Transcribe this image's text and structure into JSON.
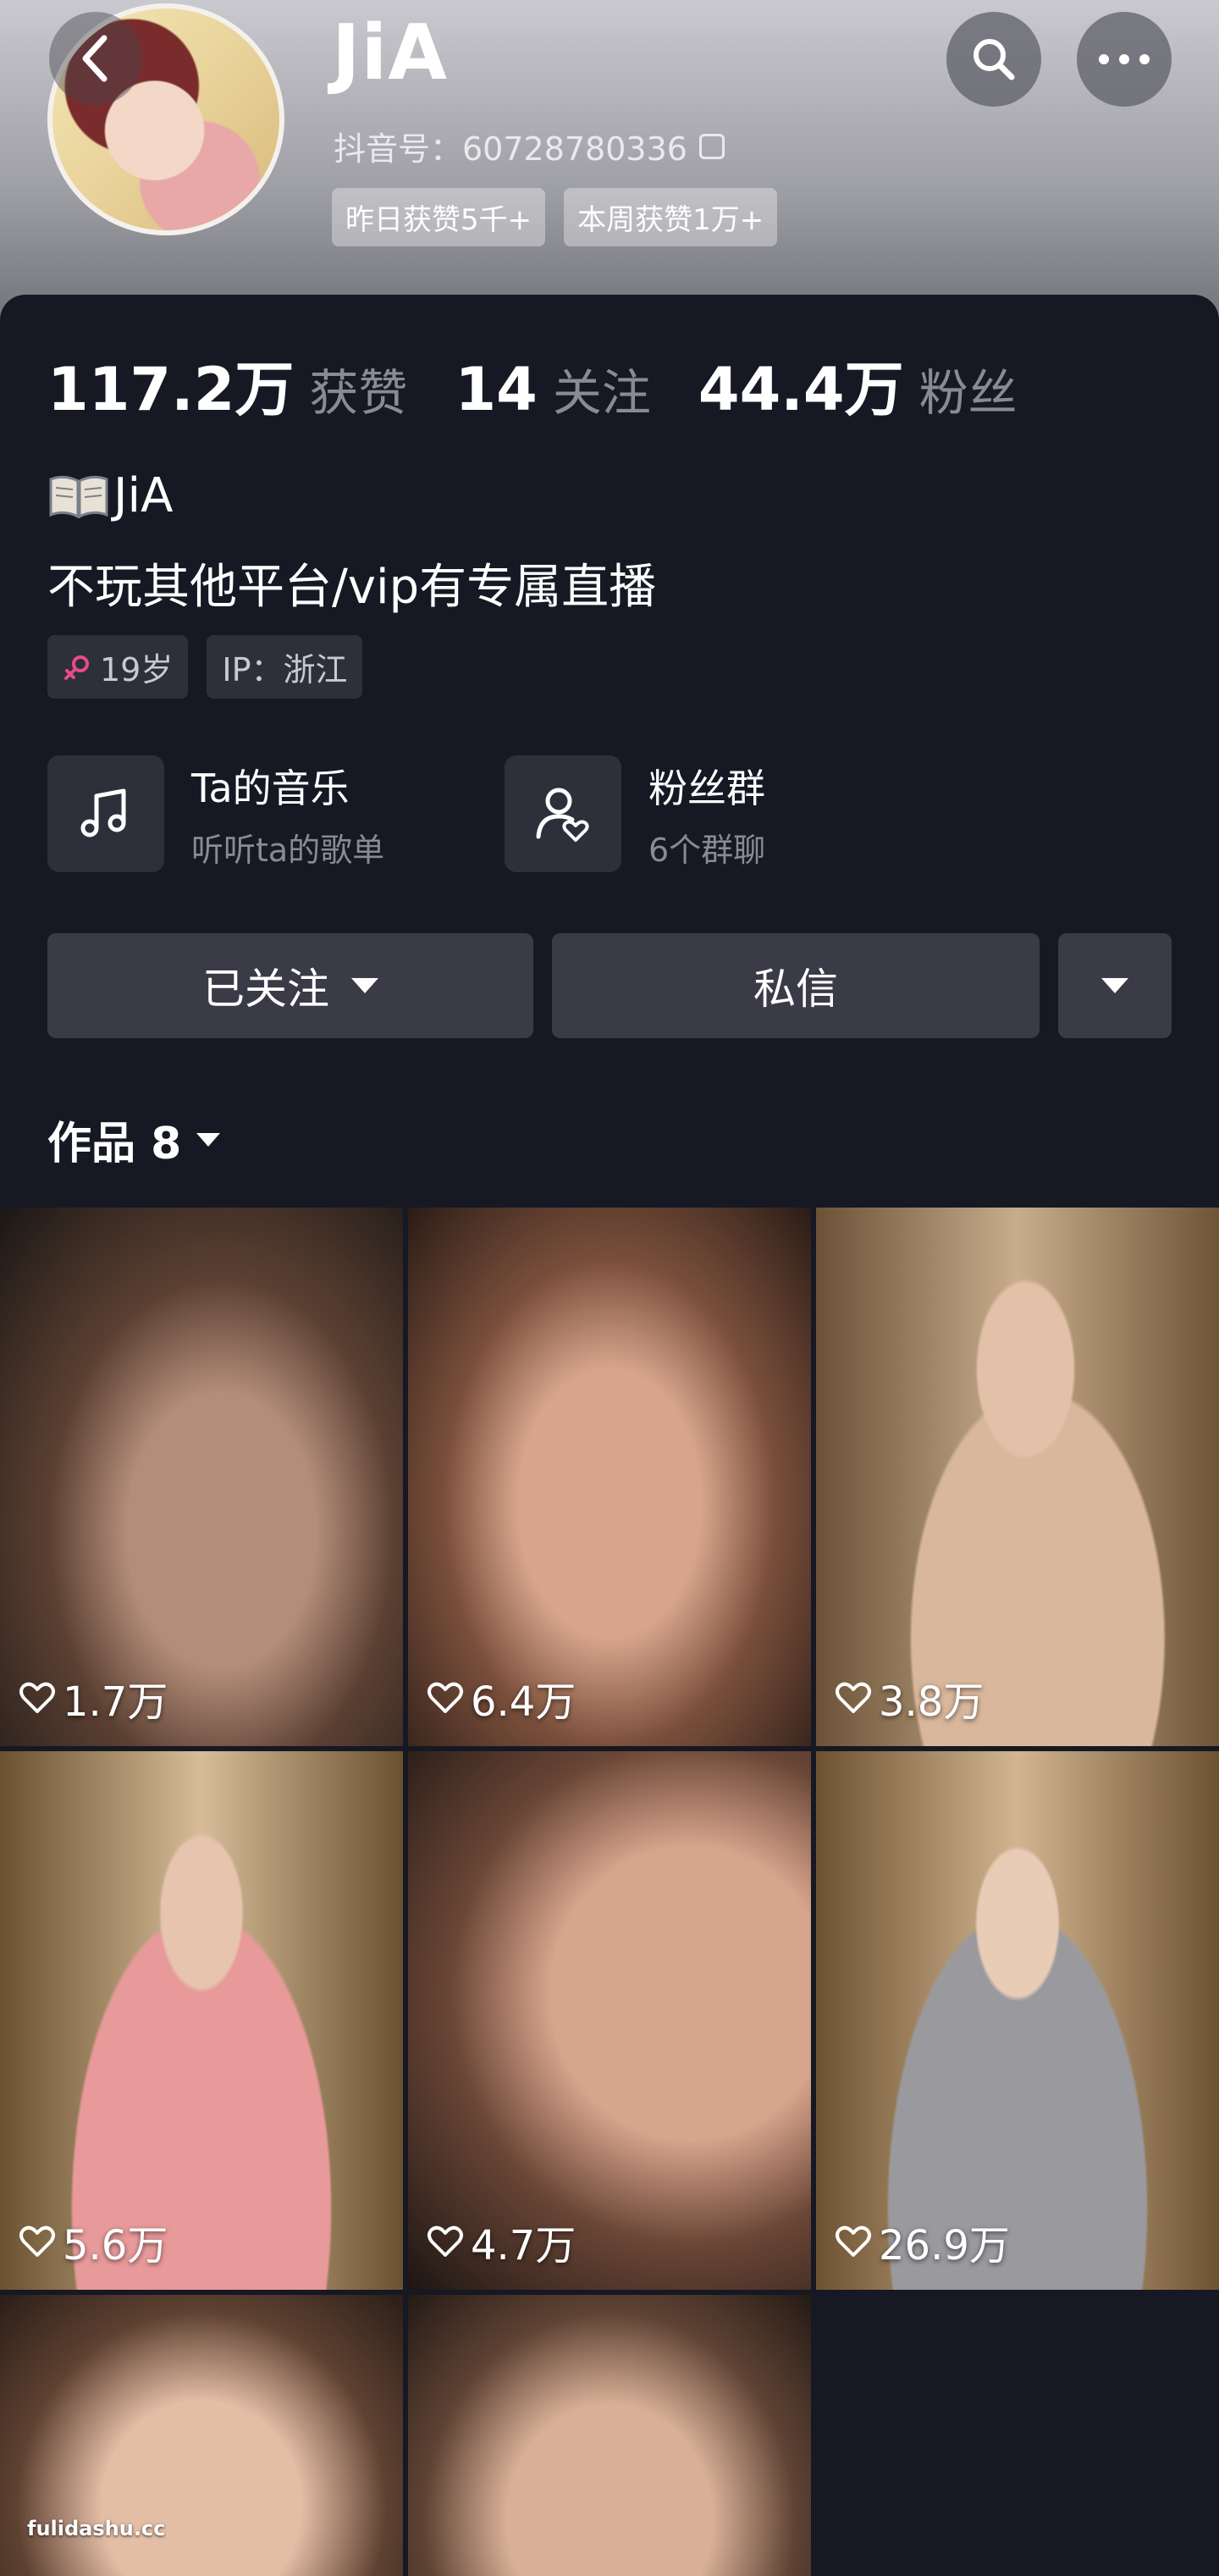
{
  "profile": {
    "username": "JiA",
    "douyin_id": "抖音号：60728780336",
    "chips": [
      "昨日获赞5千+",
      "本周获赞1万+"
    ]
  },
  "stats": [
    {
      "value": "117.2万",
      "label": "获赞"
    },
    {
      "value": "14",
      "label": "关注"
    },
    {
      "value": "44.4万",
      "label": "粉丝"
    }
  ],
  "bio": {
    "name": "JiA",
    "line": "不玩其他平台/vip有专属直播"
  },
  "tags": [
    "19岁",
    "IP：浙江"
  ],
  "features": [
    {
      "title": "Ta的音乐",
      "subtitle": "听听ta的歌单",
      "icon": "music-note-icon"
    },
    {
      "title": "粉丝群",
      "subtitle": "6个群聊",
      "icon": "fan-group-icon"
    }
  ],
  "actions": {
    "followed": "已关注",
    "message": "私信"
  },
  "works": {
    "label": "作品 8"
  },
  "videos": [
    {
      "likes": "1.7万"
    },
    {
      "likes": "6.4万"
    },
    {
      "likes": "3.8万"
    },
    {
      "likes": "5.6万"
    },
    {
      "likes": "4.7万"
    },
    {
      "likes": "26.9万"
    },
    {
      "likes": ""
    },
    {
      "likes": ""
    }
  ],
  "watermark": "fulidashu.cc",
  "colors": {
    "background": "#161823",
    "secondary_text": "#8a8b92",
    "button": "#3a3b46",
    "female_icon": "#e94a8b"
  }
}
